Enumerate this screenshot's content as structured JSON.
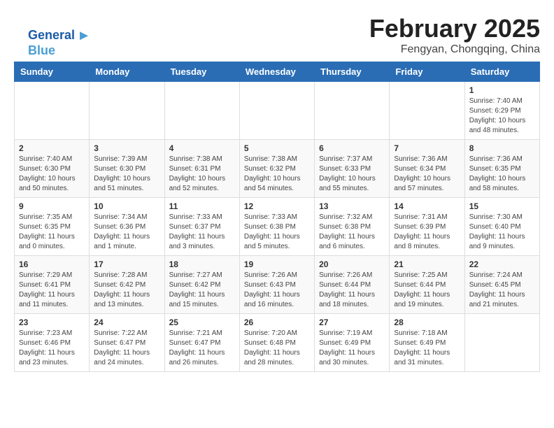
{
  "header": {
    "month_year": "February 2025",
    "location": "Fengyan, Chongqing, China"
  },
  "logo": {
    "line1": "General",
    "line2": "Blue"
  },
  "days_of_week": [
    "Sunday",
    "Monday",
    "Tuesday",
    "Wednesday",
    "Thursday",
    "Friday",
    "Saturday"
  ],
  "weeks": [
    [
      {
        "day": "",
        "info": ""
      },
      {
        "day": "",
        "info": ""
      },
      {
        "day": "",
        "info": ""
      },
      {
        "day": "",
        "info": ""
      },
      {
        "day": "",
        "info": ""
      },
      {
        "day": "",
        "info": ""
      },
      {
        "day": "1",
        "info": "Sunrise: 7:40 AM\nSunset: 6:29 PM\nDaylight: 10 hours\nand 48 minutes."
      }
    ],
    [
      {
        "day": "2",
        "info": "Sunrise: 7:40 AM\nSunset: 6:30 PM\nDaylight: 10 hours\nand 50 minutes."
      },
      {
        "day": "3",
        "info": "Sunrise: 7:39 AM\nSunset: 6:30 PM\nDaylight: 10 hours\nand 51 minutes."
      },
      {
        "day": "4",
        "info": "Sunrise: 7:38 AM\nSunset: 6:31 PM\nDaylight: 10 hours\nand 52 minutes."
      },
      {
        "day": "5",
        "info": "Sunrise: 7:38 AM\nSunset: 6:32 PM\nDaylight: 10 hours\nand 54 minutes."
      },
      {
        "day": "6",
        "info": "Sunrise: 7:37 AM\nSunset: 6:33 PM\nDaylight: 10 hours\nand 55 minutes."
      },
      {
        "day": "7",
        "info": "Sunrise: 7:36 AM\nSunset: 6:34 PM\nDaylight: 10 hours\nand 57 minutes."
      },
      {
        "day": "8",
        "info": "Sunrise: 7:36 AM\nSunset: 6:35 PM\nDaylight: 10 hours\nand 58 minutes."
      }
    ],
    [
      {
        "day": "9",
        "info": "Sunrise: 7:35 AM\nSunset: 6:35 PM\nDaylight: 11 hours\nand 0 minutes."
      },
      {
        "day": "10",
        "info": "Sunrise: 7:34 AM\nSunset: 6:36 PM\nDaylight: 11 hours\nand 1 minute."
      },
      {
        "day": "11",
        "info": "Sunrise: 7:33 AM\nSunset: 6:37 PM\nDaylight: 11 hours\nand 3 minutes."
      },
      {
        "day": "12",
        "info": "Sunrise: 7:33 AM\nSunset: 6:38 PM\nDaylight: 11 hours\nand 5 minutes."
      },
      {
        "day": "13",
        "info": "Sunrise: 7:32 AM\nSunset: 6:38 PM\nDaylight: 11 hours\nand 6 minutes."
      },
      {
        "day": "14",
        "info": "Sunrise: 7:31 AM\nSunset: 6:39 PM\nDaylight: 11 hours\nand 8 minutes."
      },
      {
        "day": "15",
        "info": "Sunrise: 7:30 AM\nSunset: 6:40 PM\nDaylight: 11 hours\nand 9 minutes."
      }
    ],
    [
      {
        "day": "16",
        "info": "Sunrise: 7:29 AM\nSunset: 6:41 PM\nDaylight: 11 hours\nand 11 minutes."
      },
      {
        "day": "17",
        "info": "Sunrise: 7:28 AM\nSunset: 6:42 PM\nDaylight: 11 hours\nand 13 minutes."
      },
      {
        "day": "18",
        "info": "Sunrise: 7:27 AM\nSunset: 6:42 PM\nDaylight: 11 hours\nand 15 minutes."
      },
      {
        "day": "19",
        "info": "Sunrise: 7:26 AM\nSunset: 6:43 PM\nDaylight: 11 hours\nand 16 minutes."
      },
      {
        "day": "20",
        "info": "Sunrise: 7:26 AM\nSunset: 6:44 PM\nDaylight: 11 hours\nand 18 minutes."
      },
      {
        "day": "21",
        "info": "Sunrise: 7:25 AM\nSunset: 6:44 PM\nDaylight: 11 hours\nand 19 minutes."
      },
      {
        "day": "22",
        "info": "Sunrise: 7:24 AM\nSunset: 6:45 PM\nDaylight: 11 hours\nand 21 minutes."
      }
    ],
    [
      {
        "day": "23",
        "info": "Sunrise: 7:23 AM\nSunset: 6:46 PM\nDaylight: 11 hours\nand 23 minutes."
      },
      {
        "day": "24",
        "info": "Sunrise: 7:22 AM\nSunset: 6:47 PM\nDaylight: 11 hours\nand 24 minutes."
      },
      {
        "day": "25",
        "info": "Sunrise: 7:21 AM\nSunset: 6:47 PM\nDaylight: 11 hours\nand 26 minutes."
      },
      {
        "day": "26",
        "info": "Sunrise: 7:20 AM\nSunset: 6:48 PM\nDaylight: 11 hours\nand 28 minutes."
      },
      {
        "day": "27",
        "info": "Sunrise: 7:19 AM\nSunset: 6:49 PM\nDaylight: 11 hours\nand 30 minutes."
      },
      {
        "day": "28",
        "info": "Sunrise: 7:18 AM\nSunset: 6:49 PM\nDaylight: 11 hours\nand 31 minutes."
      },
      {
        "day": "",
        "info": ""
      }
    ]
  ]
}
